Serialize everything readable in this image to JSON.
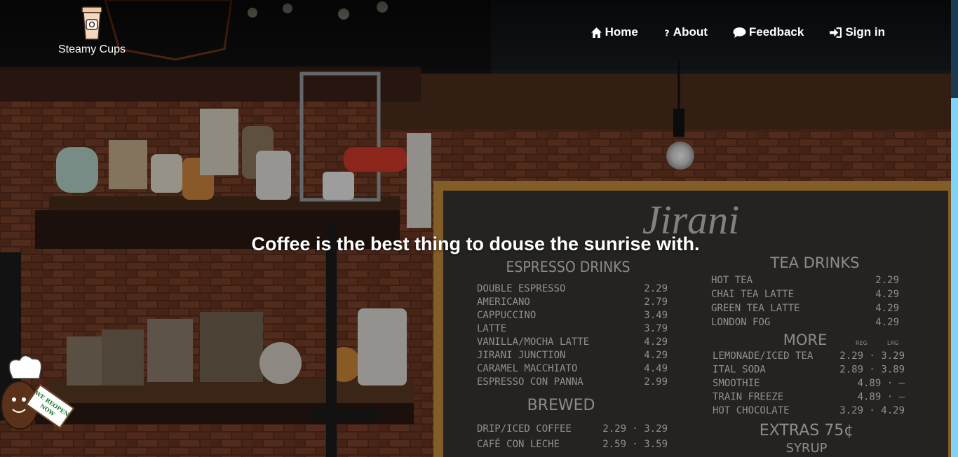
{
  "brand": {
    "name": "Steamy Cups",
    "logo_icon": "coffee-cup-icon"
  },
  "nav": {
    "items": [
      {
        "label": "Home",
        "icon": "home-icon"
      },
      {
        "label": "About",
        "icon": "question-icon"
      },
      {
        "label": "Feedback",
        "icon": "comment-icon"
      },
      {
        "label": "Sign in",
        "icon": "sign-in-icon"
      }
    ]
  },
  "hero": {
    "tagline": "Coffee is the best thing to douse the sunrise with."
  },
  "menu_board": {
    "title": "Jirani",
    "espresso_heading": "ESPRESSO DRINKS",
    "espresso": [
      {
        "item": "DOUBLE ESPRESSO",
        "price": "2.29"
      },
      {
        "item": "AMERICANO",
        "price": "2.79"
      },
      {
        "item": "CAPPUCCINO",
        "price": "3.49"
      },
      {
        "item": "LATTE",
        "price": "3.79"
      },
      {
        "item": "VANILLA/MOCHA LATTE",
        "price": "4.29"
      },
      {
        "item": "JIRANI JUNCTION",
        "price": "4.29"
      },
      {
        "item": "CARAMEL MACCHIATO",
        "price": "4.49"
      },
      {
        "item": "ESPRESSO CON PANNA",
        "price": "2.99"
      }
    ],
    "tea_heading": "TEA DRINKS",
    "tea": [
      {
        "item": "HOT TEA",
        "price": "2.29"
      },
      {
        "item": "CHAI TEA LATTE",
        "price": "4.29"
      },
      {
        "item": "GREEN TEA LATTE",
        "price": "4.29"
      },
      {
        "item": "LONDON FOG",
        "price": "4.29"
      }
    ],
    "more_heading": "MORE",
    "size_labels": [
      "REG",
      "LRG"
    ],
    "more": [
      {
        "item": "LEMONADE/ICED TEA",
        "price": "2.29 · 3.29"
      },
      {
        "item": "ITAL  SODA",
        "price": "2.89 · 3.89"
      },
      {
        "item": "SMOOTHIE",
        "price": "4.89 · —"
      },
      {
        "item": "TRAIN FREEZE",
        "price": "4.89 · —"
      },
      {
        "item": "HOT CHOCOLATE",
        "price": "3.29 · 4.29"
      }
    ],
    "brewed_heading": "BREWED",
    "brewed": [
      {
        "item": "DRIP/ICED COFFEE",
        "price": "2.29 · 3.29"
      },
      {
        "item": "CAFÉ CON LECHE",
        "price": "2.59 · 3.59"
      }
    ],
    "extras_heading": "EXTRAS 75¢",
    "extras": [
      "SYRUP"
    ]
  },
  "mascot": {
    "sign_text": "WE REOPEN NOW",
    "icon": "chef-bean-mascot-icon"
  },
  "colors": {
    "chalkboard": "#3a3733",
    "brick": "#6b3a26",
    "wood": "#4a2d1c",
    "scrollbar_thumb": "#7fd3f7"
  }
}
